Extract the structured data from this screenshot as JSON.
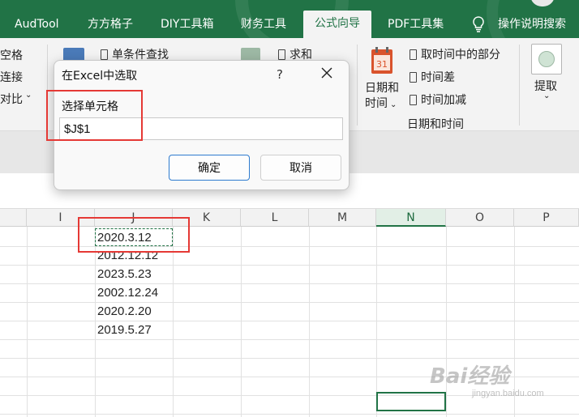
{
  "tabs": [
    {
      "label": "AudTool",
      "active": false
    },
    {
      "label": "方方格子",
      "active": false
    },
    {
      "label": "DIY工具箱",
      "active": false
    },
    {
      "label": "财务工具",
      "active": false
    },
    {
      "label": "公式向导",
      "active": true
    },
    {
      "label": "PDF工具集",
      "active": false
    }
  ],
  "tell_me": "操作说明搜索",
  "ribbon": {
    "left_partial": [
      "空格",
      "连接",
      "对比"
    ],
    "lookup": {
      "single_condition": "单条件查找"
    },
    "math": {
      "sum": "求和"
    },
    "datetime": {
      "big_button": "日期和",
      "big_button_2": "时间",
      "items": [
        "取时间中的部分",
        "时间差",
        "时间加减"
      ],
      "group_label": "日期和时间"
    },
    "extract": "提取"
  },
  "dialog": {
    "title": "在Excel中选取",
    "help": "?",
    "field_label": "选择单元格",
    "field_value": "$J$1",
    "ok": "确定",
    "cancel": "取消"
  },
  "columns": [
    "I",
    "J",
    "K",
    "L",
    "M",
    "N",
    "O",
    "P"
  ],
  "selected_column": "N",
  "cells_J": [
    "2020.3.12",
    "2012.12.12",
    "2023.5.23",
    "2002.12.24",
    "2020.2.20",
    "2019.5.27"
  ],
  "watermark": {
    "brand": "Bai经验",
    "url": "jingyan.baidu.com"
  },
  "colors": {
    "excel_green": "#217346",
    "highlight_red": "#e53935",
    "ok_border": "#2e7bcf"
  }
}
